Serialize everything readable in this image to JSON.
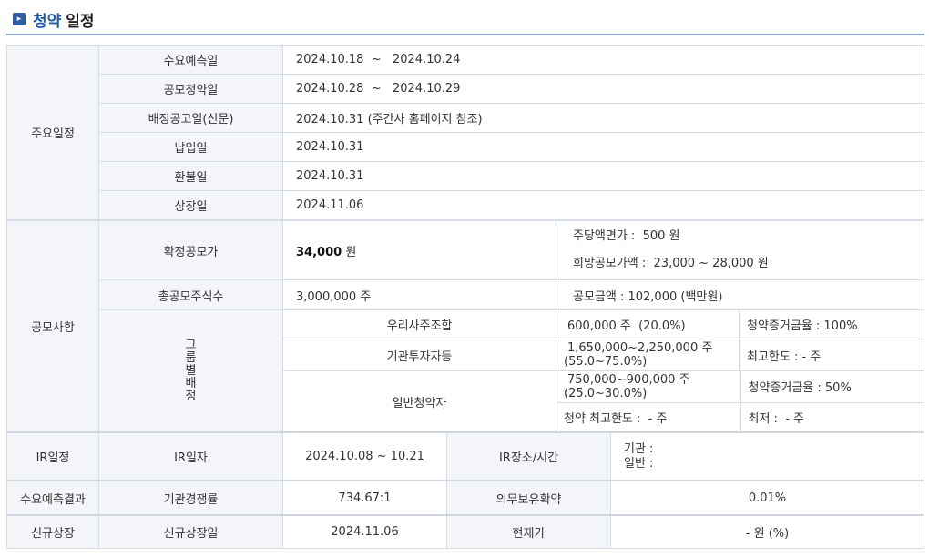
{
  "page": {
    "title_accent": "청약",
    "title_rest": "일정"
  },
  "schedule": {
    "group_label": "주요일정",
    "rows": [
      {
        "label": "수요예측일",
        "value": "2024.10.18  ~   2024.10.24"
      },
      {
        "label": "공모청약일",
        "value": "2024.10.28  ~   2024.10.29"
      },
      {
        "label": "배정공고일(신문)",
        "value": "2024.10.31 (주간사 홈페이지 참조)"
      },
      {
        "label": "납입일",
        "value": "2024.10.31"
      },
      {
        "label": "환불일",
        "value": "2024.10.31"
      },
      {
        "label": "상장일",
        "value": "2024.11.06"
      }
    ]
  },
  "offering": {
    "group_label": "공모사항",
    "final_price_label": "확정공모가",
    "final_price_value": "34,000",
    "final_price_unit": "원",
    "par_value": "주당액면가 :  500 원",
    "desired_price": "희망공모가액 :  23,000 ~ 28,000 원",
    "total_shares_label": "총공모주식수",
    "total_shares_value": "3,000,000 주",
    "total_amount": "공모금액 : 102,000 (백만원)",
    "group_alloc_label": [
      "그",
      "룹",
      "별",
      "배",
      "정"
    ],
    "groups": [
      {
        "name": "우리사주조합",
        "shares": "600,000 주  (20.0%)",
        "note": "청약증거금율 : 100%"
      },
      {
        "name": "기관투자자등",
        "shares_line1": "1,650,000~2,250,000 주",
        "shares_line2": "(55.0~75.0%)",
        "note": "최고한도 :  - 주"
      },
      {
        "name": "일반청약자",
        "shares_line1": "750,000~900,000 주",
        "shares_line2": "(25.0~30.0%)",
        "note": "청약증거금율 : 50%",
        "limit": "청약 최고한도 :  - 주",
        "min": "최저 :  - 주"
      }
    ]
  },
  "ir": {
    "label": "IR일정",
    "date_label": "IR일자",
    "date_value": "2024.10.08 ~ 10.21",
    "place_label": "IR장소/시간",
    "place_line1": "기관 :",
    "place_line2": "일반 :"
  },
  "demand": {
    "label": "수요예측결과",
    "competition_label": "기관경쟁률",
    "competition_value": "734.67:1",
    "lockup_label": "의무보유확약",
    "lockup_value": "0.01%"
  },
  "listing": {
    "label": "신규상장",
    "date_label": "신규상장일",
    "date_value": "2024.11.06",
    "price_label": "현재가",
    "price_value": "- 원 (%)"
  }
}
